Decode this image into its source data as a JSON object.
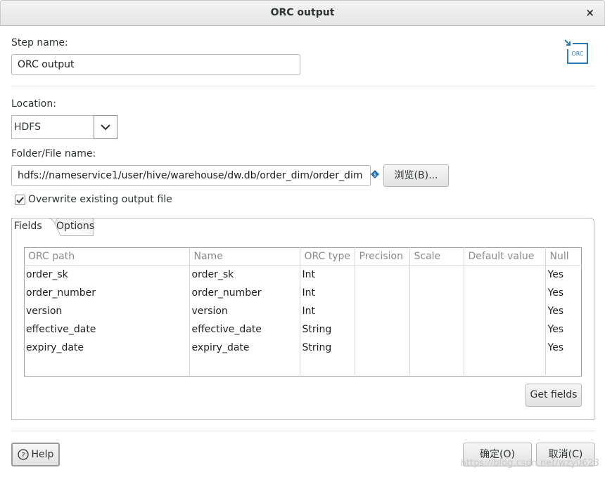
{
  "window": {
    "title": "ORC output",
    "close_icon": "×"
  },
  "step": {
    "label": "Step name:",
    "value": "ORC output"
  },
  "location": {
    "label": "Location:",
    "value": "HDFS"
  },
  "file": {
    "label": "Folder/File name:",
    "value": "hdfs://nameservice1/user/hive/warehouse/dw.db/order_dim/order_dim",
    "browse_label": "浏览(B)..."
  },
  "overwrite": {
    "label": "Overwrite existing output file",
    "checked": true
  },
  "tabs": [
    {
      "label": "Fields"
    },
    {
      "label": "Options"
    }
  ],
  "table": {
    "columns": [
      "ORC path",
      "Name",
      "ORC type",
      "Precision",
      "Scale",
      "Default value",
      "Null"
    ],
    "rows": [
      [
        "order_sk",
        "order_sk",
        "Int",
        "",
        "",
        "",
        "Yes"
      ],
      [
        "order_number",
        "order_number",
        "Int",
        "",
        "",
        "",
        "Yes"
      ],
      [
        "version",
        "version",
        "Int",
        "",
        "",
        "",
        "Yes"
      ],
      [
        "effective_date",
        "effective_date",
        "String",
        "",
        "",
        "",
        "Yes"
      ],
      [
        "expiry_date",
        "expiry_date",
        "String",
        "",
        "",
        "",
        "Yes"
      ]
    ]
  },
  "buttons": {
    "get_fields": "Get fields",
    "help": "Help",
    "ok": "确定(O)",
    "cancel": "取消(C)"
  },
  "watermark": "https://blog.csdn.net/wzy0623",
  "colors": {
    "accent": "#1f6fb5",
    "icon": "#2c7bb6"
  }
}
